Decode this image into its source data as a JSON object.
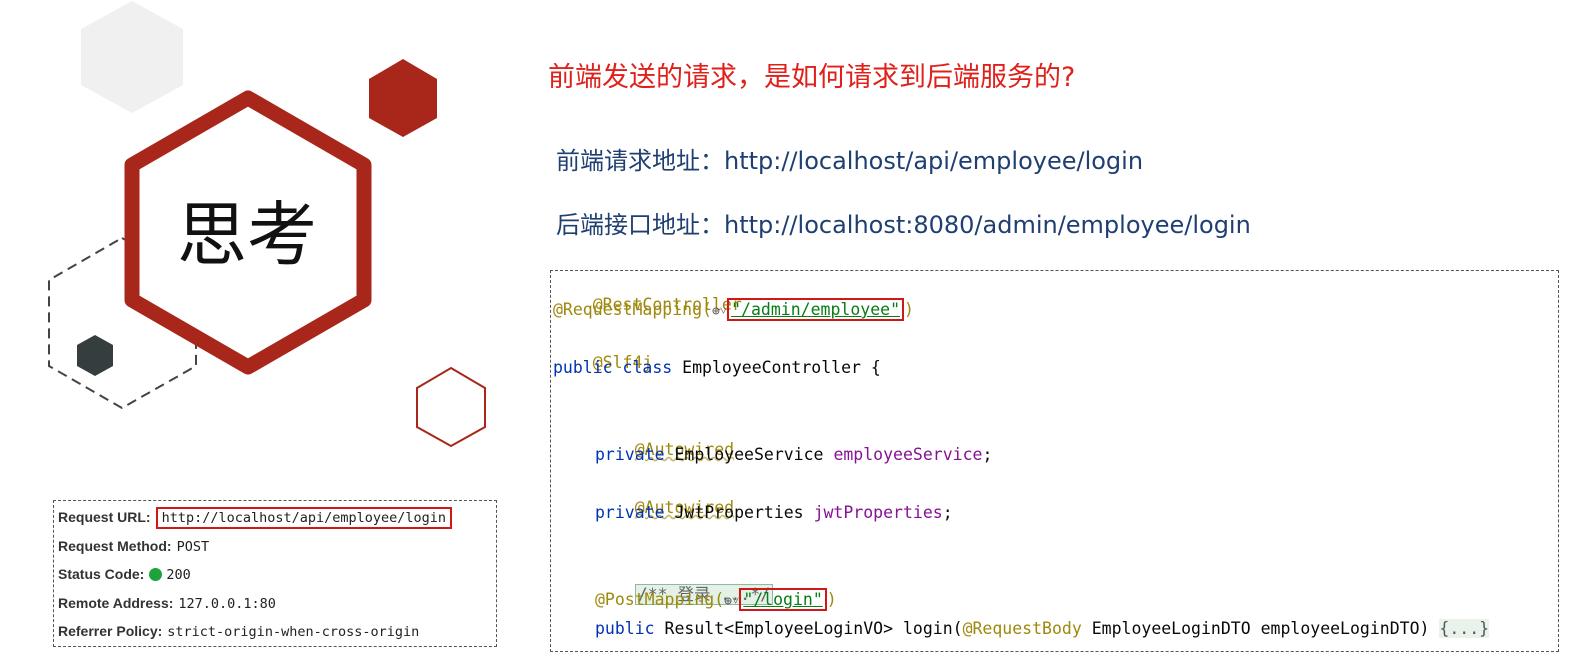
{
  "slide": {
    "think_title": "思考",
    "question": "前端发送的请求，是如何请求到后端服务的?",
    "front_address": "前端请求地址：http://localhost/api/employee/login",
    "back_address": "后端接口地址：http://localhost:8080/admin/employee/login"
  },
  "code": {
    "line1": "@RestController",
    "line2_annot": "@RequestMapping(",
    "line2_path": "\"/admin/employee\"",
    "line2_close": ")",
    "line3": "@Slf4j",
    "line4_kw": "public class",
    "line4_name": " EmployeeController {",
    "line5": "@Autowired",
    "line6_kw": "private",
    "line6_type": " EmployeeService ",
    "line6_field": "employeeService",
    "line6_end": ";",
    "line7": "@Autowired",
    "line8_kw": "private",
    "line8_type": " JwtProperties ",
    "line8_field": "jwtProperties",
    "line8_end": ";",
    "line9_comment": "/** 登录 ...*/",
    "line10_annot": "@PostMapping(",
    "line10_path": "\"/login\"",
    "line10_close": ")",
    "line11_kw": "public",
    "line11_sig": " Result<EmployeeLoginVO> login(",
    "line11_annot": "@RequestBody",
    "line11_params": " EmployeeLoginDTO employeeLoginDTO) ",
    "line11_fold": "{...}"
  },
  "request": {
    "url_label": "Request URL:",
    "url_value": "http://localhost/api/employee/login",
    "method_label": "Request Method:",
    "method_value": "POST",
    "status_label": "Status Code:",
    "status_value": "200",
    "remote_label": "Remote Address:",
    "remote_value": "127.0.0.1:80",
    "referrer_label": "Referrer Policy:",
    "referrer_value": "strict-origin-when-cross-origin"
  },
  "icons": {
    "globe": "globe-icon",
    "status_dot": "green-status-dot"
  },
  "colors": {
    "brand_red": "#a3261a",
    "question_red": "#e0201b",
    "address_blue": "#1f3f72",
    "highlight_red": "#d01818",
    "status_green": "#1ea23c"
  }
}
